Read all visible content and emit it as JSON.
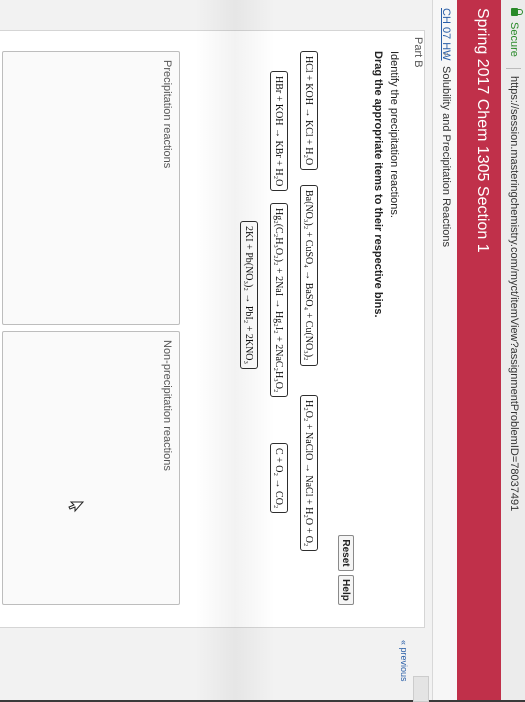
{
  "browser": {
    "secure_label": "Secure",
    "url": "https://session.masteringchemistry.com/myct/itemView?assignmentProblemID=78037491"
  },
  "course": {
    "title": "Spring 2017 Chem 1305 Section 1"
  },
  "breadcrumb": {
    "parent": "CH 07 HW",
    "current": "Solubility and Precipitation Reactions"
  },
  "nav": {
    "previous_label": "« previous"
  },
  "problem": {
    "part_label": "Part B",
    "instruction": "Identify the precipitation reactions.",
    "drag_instruction": "Drag the appropriate items to their respective bins.",
    "reset_label": "Reset",
    "help_label": "Help"
  },
  "items": [
    "HCl + KOH → KCl + H₂O",
    "Ba(NO₃)₂ + CuSO₄ → BaSO₄ + Cu(NO₃)₂",
    "H₂O₂ + NaClO → NaCl + H₂O + O₂",
    "HBr + KOH → KBr + H₂O",
    "Hg₂(C₂H₃O₂)₂ + 2NaI → Hg₂I₂ + 2NaC₂H₃O₂",
    "C + O₂ → CO₂",
    "2KI + Pb(NO₃)₂ → PbI₂ + 2KNO₃"
  ],
  "bins": {
    "precipitation_label": "Precipitation reactions",
    "non_precipitation_label": "Non-precipitation reactions"
  }
}
